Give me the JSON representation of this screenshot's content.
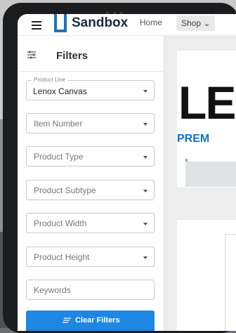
{
  "header": {
    "logo_text": "Sandbox",
    "nav": {
      "home": "Home",
      "shop": "Shop ⌄"
    }
  },
  "sidebar": {
    "title": "Filters",
    "fields": [
      {
        "legend": "Product Line",
        "value": "Lenox Canvas",
        "type": "select"
      },
      {
        "label": "Item Number",
        "type": "select"
      },
      {
        "label": "Product Type",
        "type": "select"
      },
      {
        "label": "Product Subtype",
        "type": "select"
      },
      {
        "label": "Product Width",
        "type": "select"
      },
      {
        "label": "Product Height",
        "type": "select"
      },
      {
        "label": "Keywords",
        "type": "text"
      }
    ],
    "clear_button": "Clear Filters"
  },
  "hero": {
    "big_text": "LE",
    "sub_text": "PREM"
  },
  "colors": {
    "accent": "#1e86e3",
    "logo": "#1d73b8"
  }
}
